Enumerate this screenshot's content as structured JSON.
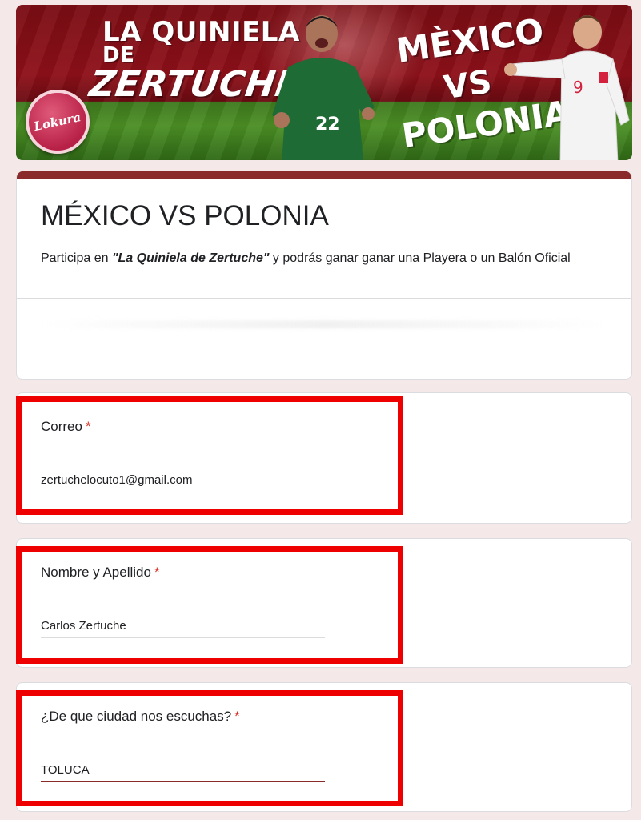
{
  "banner": {
    "title_line1": "LA QUINIELA",
    "title_line2": "DE",
    "title_line3": "ZERTUCHE",
    "vs_line1": "MÈXICO",
    "vs_line2": "VS",
    "vs_line3": "POLONIA",
    "logo_text": "Lokura",
    "green_jersey_number": "22",
    "white_jersey_number": "9"
  },
  "form": {
    "title": "MÉXICO VS POLONIA",
    "description_prefix": "Participa en ",
    "description_emphasis": "\"La Quiniela de Zertuche\"",
    "description_suffix": " y podrás ganar ganar una Playera o un Balón Oficial"
  },
  "questions": [
    {
      "label": "Correo",
      "required_mark": "*",
      "value": "zertuchelocuto1@gmail.com"
    },
    {
      "label": "Nombre y Apellido",
      "required_mark": "*",
      "value": "Carlos Zertuche"
    },
    {
      "label": "¿De que ciudad nos escuchas?",
      "required_mark": "*",
      "value": "TOLUCA"
    }
  ],
  "colors": {
    "page_background": "#f4e9e8",
    "accent": "#8a2a2a",
    "required": "#d93025",
    "highlight": "#ee0000"
  }
}
